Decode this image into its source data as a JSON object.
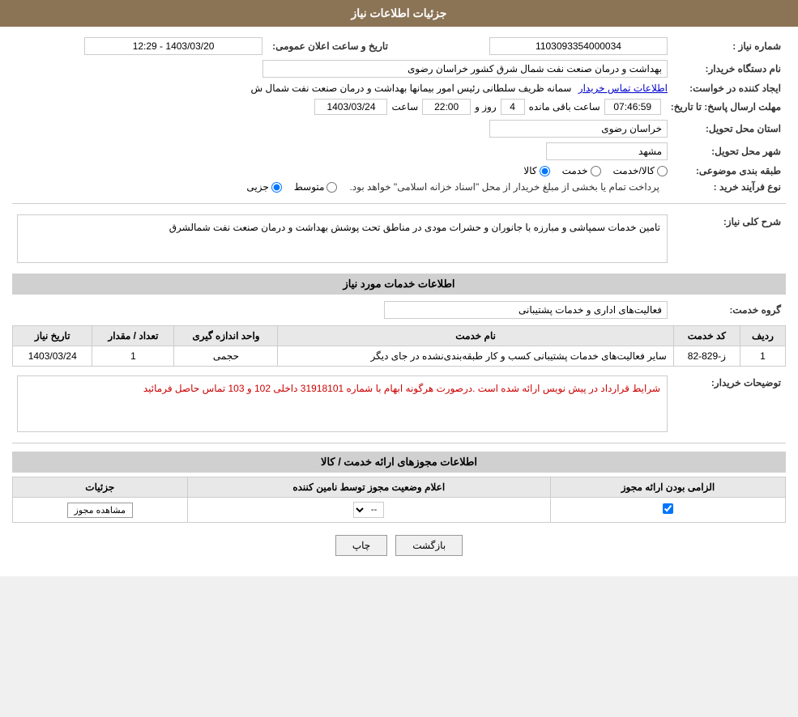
{
  "header": {
    "title": "جزئیات اطلاعات نیاز"
  },
  "fields": {
    "need_number_label": "شماره نیاز :",
    "need_number_value": "1103093354000034",
    "announce_datetime_label": "تاریخ و ساعت اعلان عمومی:",
    "announce_datetime_value": "1403/03/20 - 12:29",
    "buyer_org_label": "نام دستگاه خریدار:",
    "buyer_org_value": "بهداشت و درمان صنعت نفت شمال شرق کشور   خراسان رضوی",
    "creator_label": "ایجاد کننده در خواست:",
    "creator_value": "سمانه ظریف سلطانی رئیس امور بیمانها بهداشت و درمان صنعت نفت شمال ش",
    "creator_link": "اطلاعات تماس خریدار",
    "reply_deadline_label": "مهلت ارسال پاسخ: تا تاریخ:",
    "deadline_date": "1403/03/24",
    "deadline_time": "22:00",
    "deadline_days": "4",
    "deadline_remaining": "07:46:59",
    "deadline_unit1": "ساعت",
    "deadline_unit2": "روز و",
    "deadline_unit3": "ساعت باقی مانده",
    "delivery_province_label": "استان محل تحویل:",
    "delivery_province_value": "خراسان رضوی",
    "delivery_city_label": "شهر محل تحویل:",
    "delivery_city_value": "مشهد",
    "category_label": "طبقه بندی موضوعی:",
    "category_kala": "کالا",
    "category_khadamat": "خدمت",
    "category_kala_khadamat": "کالا/خدمت",
    "process_label": "نوع فرآیند خرید :",
    "process_jazee": "جزیی",
    "process_motavaset": "متوسط",
    "process_note": "پرداخت تمام یا بخشی از مبلغ خریدار از محل \"اسناد خزانه اسلامی\" خواهد بود.",
    "general_desc_label": "شرح کلی نیاز:",
    "general_desc_value": "تامین خدمات سمپاشی و مبارزه با جانوران و حشرات مودی در مناطق تحت پوشش بهداشت و درمان صنعت نفت شمالشرق",
    "service_info_label": "اطلاعات خدمات مورد نیاز",
    "service_group_label": "گروه خدمت:",
    "service_group_value": "فعالیت‌های اداری و خدمات پشتیبانی",
    "table": {
      "headers": [
        "ردیف",
        "کد خدمت",
        "نام خدمت",
        "واحد اندازه گیری",
        "تعداد / مقدار",
        "تاریخ نیاز"
      ],
      "rows": [
        {
          "row_num": "1",
          "code": "ز-829-82",
          "name": "سایر فعالیت‌های خدمات پشتیبانی کسب و کار طبقه‌بندی‌نشده در جای دیگر",
          "unit": "حجمی",
          "quantity": "1",
          "date": "1403/03/24"
        }
      ]
    },
    "buyer_notes_label": "توضیحات خریدار:",
    "buyer_notes_value": "شرایط قرارداد در پیش نویس ارائه شده است .درصورت هرگونه ابهام با شماره 31918101 داخلی 102 و 103 تماس حاصل فرمائید",
    "license_section_label": "اطلاعات مجوزهای ارائه خدمت / کالا",
    "license_table": {
      "headers": [
        "الزامی بودن ارائه مجوز",
        "اعلام وضعیت مجوز توسط نامین کننده",
        "جزئیات"
      ],
      "rows": [
        {
          "required": true,
          "status": "--",
          "details_btn": "مشاهده مجوز"
        }
      ]
    }
  },
  "buttons": {
    "return_label": "بازگشت",
    "print_label": "چاپ"
  }
}
